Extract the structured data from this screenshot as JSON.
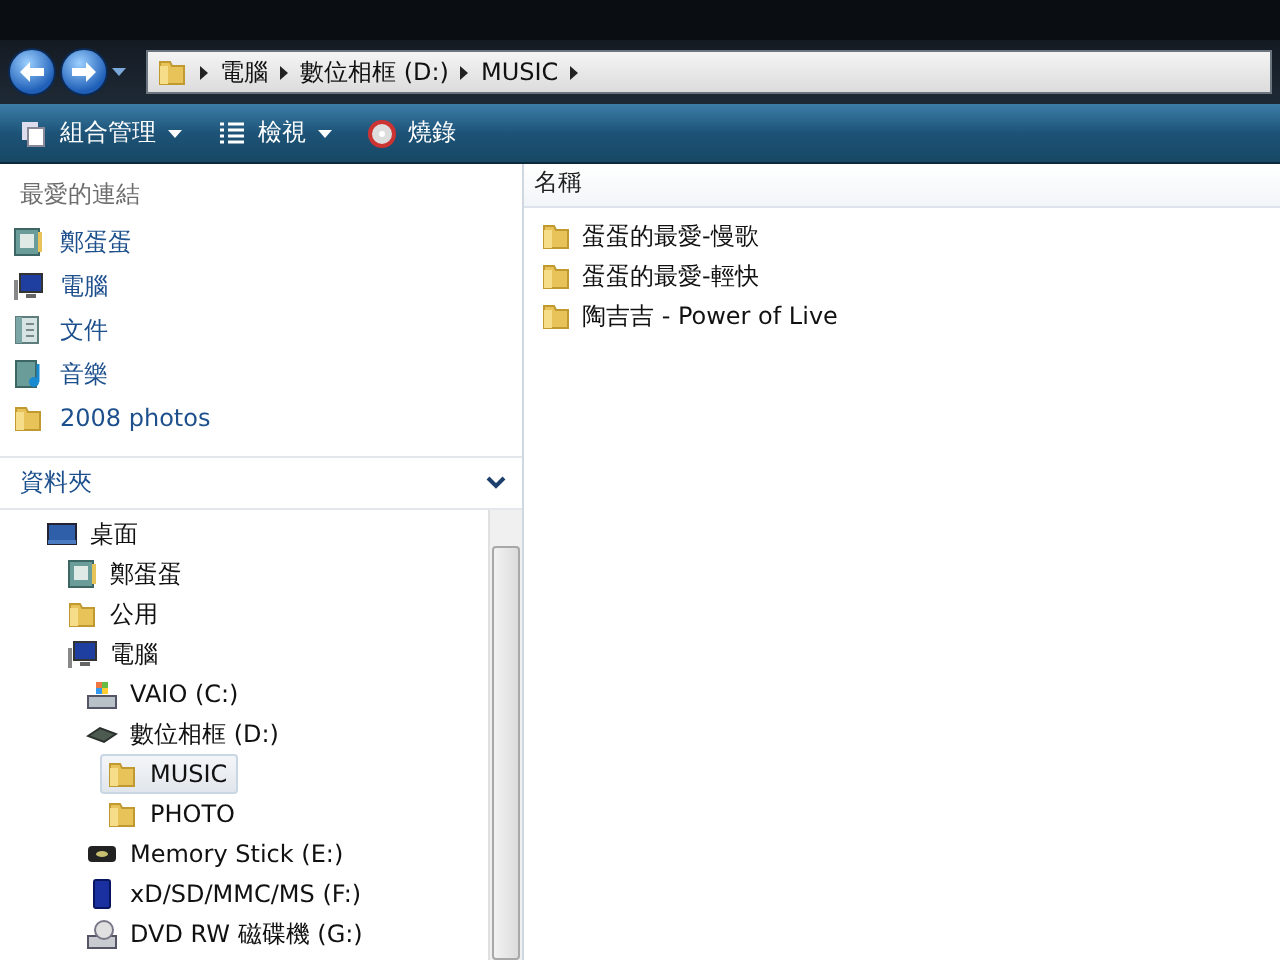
{
  "address_bar": {
    "segments": [
      "電腦",
      "數位相框 (D:)",
      "MUSIC"
    ]
  },
  "toolbar": {
    "buttons": [
      {
        "label": "組合管理",
        "kind": "organize",
        "dropdown": true
      },
      {
        "label": "檢視",
        "kind": "views",
        "dropdown": true
      },
      {
        "label": "燒錄",
        "kind": "burn",
        "dropdown": false
      }
    ]
  },
  "favorite_links": {
    "title": "最愛的連結",
    "items": [
      {
        "label": "鄭蛋蛋",
        "kind": "contact"
      },
      {
        "label": "電腦",
        "kind": "computer"
      },
      {
        "label": "文件",
        "kind": "document"
      },
      {
        "label": "音樂",
        "kind": "music"
      },
      {
        "label": "2008 photos",
        "kind": "folder"
      }
    ]
  },
  "folders": {
    "title": "資料夾",
    "expanded": true,
    "tree": [
      {
        "label": "桌面",
        "kind": "desktop",
        "selected": false,
        "children": [
          {
            "label": "鄭蛋蛋",
            "kind": "contact",
            "selected": false
          },
          {
            "label": "公用",
            "kind": "folder",
            "selected": false
          },
          {
            "label": "電腦",
            "kind": "computer",
            "selected": false,
            "children": [
              {
                "label": "VAIO (C:)",
                "kind": "system-drive",
                "selected": false
              },
              {
                "label": "數位相框 (D:)",
                "kind": "frame-drive",
                "selected": false,
                "children": [
                  {
                    "label": "MUSIC",
                    "kind": "folder",
                    "selected": true
                  },
                  {
                    "label": "PHOTO",
                    "kind": "folder",
                    "selected": false
                  }
                ]
              },
              {
                "label": "Memory Stick (E:)",
                "kind": "memory-stick",
                "selected": false
              },
              {
                "label": "xD/SD/MMC/MS (F:)",
                "kind": "card",
                "selected": false
              },
              {
                "label": "DVD RW 磁碟機 (G:)",
                "kind": "dvd",
                "selected": false
              }
            ]
          }
        ]
      }
    ]
  },
  "file_list": {
    "columns": [
      "名稱"
    ],
    "items": [
      "蛋蛋的最愛-慢歌",
      "蛋蛋的最愛-輕快",
      "陶吉吉 - Power of Live"
    ]
  }
}
